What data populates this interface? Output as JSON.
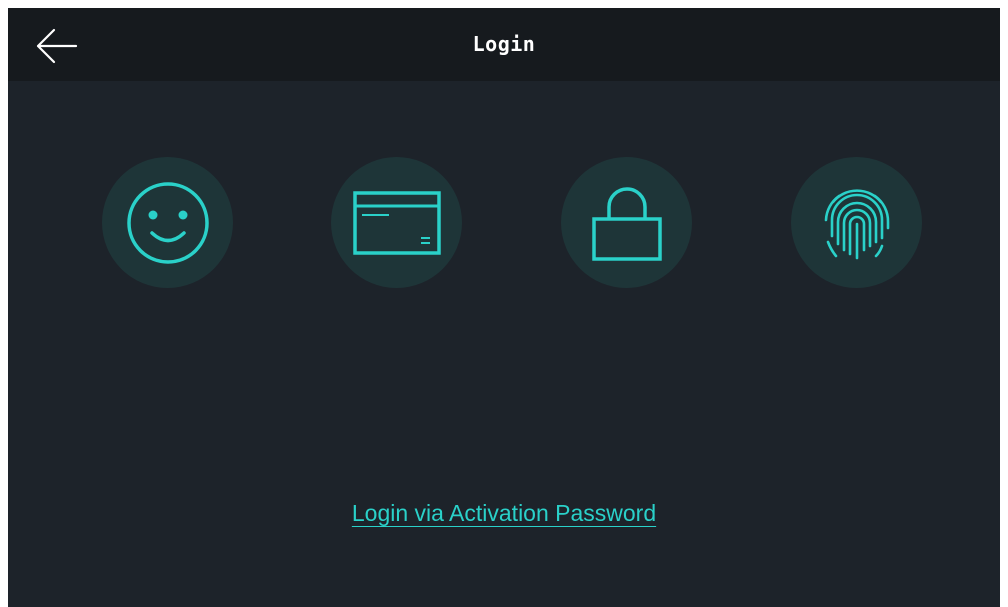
{
  "header": {
    "title": "Login",
    "back_icon": "arrow-left-icon"
  },
  "login_methods": [
    {
      "id": "face",
      "icon": "face-icon"
    },
    {
      "id": "card",
      "icon": "card-icon"
    },
    {
      "id": "password",
      "icon": "lock-icon"
    },
    {
      "id": "fingerprint",
      "icon": "fingerprint-icon"
    }
  ],
  "activation_link": {
    "label": "Login via Activation Password"
  },
  "colors": {
    "background": "#1d232a",
    "header_background": "#161a1e",
    "accent": "#2ad1c9",
    "icon_circle": "#1e3538",
    "title_text": "#ffffff"
  }
}
